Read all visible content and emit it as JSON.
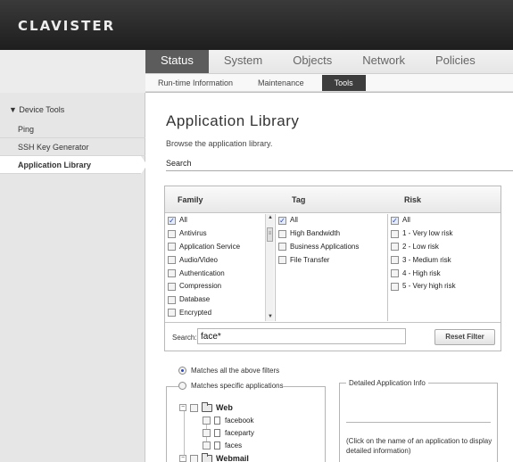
{
  "brand": {
    "logo": "CLAVISTER"
  },
  "nav": {
    "main_tabs": [
      {
        "label": "Status",
        "active": true
      },
      {
        "label": "System",
        "active": false
      },
      {
        "label": "Objects",
        "active": false
      },
      {
        "label": "Network",
        "active": false
      },
      {
        "label": "Policies",
        "active": false
      }
    ],
    "sub_tabs": [
      {
        "label": "Run-time Information",
        "active": false
      },
      {
        "label": "Maintenance",
        "active": false
      },
      {
        "label": "Tools",
        "active": true
      }
    ]
  },
  "sidebar": {
    "group": "▼ Device Tools",
    "items": [
      {
        "label": "Ping",
        "active": false
      },
      {
        "label": "SSH Key Generator",
        "active": false
      },
      {
        "label": "Application Library",
        "active": true
      }
    ]
  },
  "page": {
    "title": "Application Library",
    "description": "Browse the application library.",
    "section": "Search"
  },
  "filters": {
    "family_header": "Family",
    "tag_header": "Tag",
    "risk_header": "Risk",
    "family": [
      {
        "label": "All",
        "checked": true
      },
      {
        "label": "Antivirus",
        "checked": false
      },
      {
        "label": "Application Service",
        "checked": false
      },
      {
        "label": "Audio/Video",
        "checked": false
      },
      {
        "label": "Authentication",
        "checked": false
      },
      {
        "label": "Compression",
        "checked": false
      },
      {
        "label": "Database",
        "checked": false
      },
      {
        "label": "Encrypted",
        "checked": false
      }
    ],
    "tag": [
      {
        "label": "All",
        "checked": true
      },
      {
        "label": "High Bandwidth",
        "checked": false
      },
      {
        "label": "Business Applications",
        "checked": false
      },
      {
        "label": "File Transfer",
        "checked": false
      }
    ],
    "risk": [
      {
        "label": "All",
        "checked": true
      },
      {
        "label": "1 - Very low risk",
        "checked": false
      },
      {
        "label": "2 - Low risk",
        "checked": false
      },
      {
        "label": "3 - Medium risk",
        "checked": false
      },
      {
        "label": "4 - High risk",
        "checked": false
      },
      {
        "label": "5 - Very high risk",
        "checked": false
      }
    ],
    "search_label": "Search:",
    "search_value": "face*",
    "reset_label": "Reset Filter"
  },
  "match": {
    "all_label": "Matches all the above filters",
    "specific_label": "Matches specific applications",
    "selected": "all"
  },
  "tree": {
    "web_label": "Web",
    "web_children": [
      "facebook",
      "faceparty",
      "faces"
    ],
    "webmail_label": "Webmail"
  },
  "info": {
    "legend": "Detailed Application Info",
    "note": "(Click on the name of an application to display detailed information)"
  },
  "colors": {
    "active_tab": "#5c5c5c",
    "topbar": "#2a2a2a",
    "sidebar": "#e6e6e6"
  }
}
